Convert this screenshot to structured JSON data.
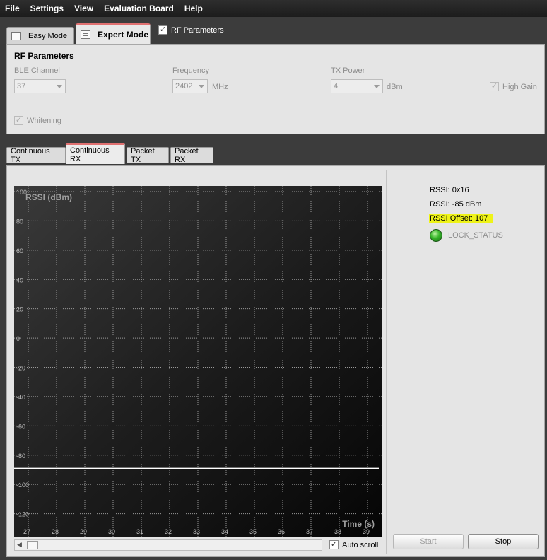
{
  "menu": [
    "File",
    "Settings",
    "View",
    "Evaluation Board",
    "Help"
  ],
  "mode_tabs": {
    "easy": "Easy Mode",
    "expert": "Expert Mode",
    "active": "Expert Mode"
  },
  "rf_toggle": {
    "label": "RF Parameters",
    "checked": true
  },
  "rf_params": {
    "title": "RF Parameters",
    "ble_channel": {
      "label": "BLE Channel",
      "value": "37"
    },
    "frequency": {
      "label": "Frequency",
      "value": "2402",
      "unit": "MHz"
    },
    "tx_power": {
      "label": "TX Power",
      "value": "4",
      "unit": "dBm"
    },
    "high_gain": {
      "label": "High Gain",
      "checked": true
    },
    "whitening": {
      "label": "Whitening",
      "checked": true
    }
  },
  "function_tabs": [
    "Continuous TX",
    "Continuous RX",
    "Packet TX",
    "Packet RX"
  ],
  "active_function_tab": "Continuous RX",
  "status": {
    "rssi_hex": "RSSI: 0x16",
    "rssi_dbm": "RSSI: -85 dBm",
    "rssi_offset": "RSSI Offset: 107",
    "lock_status": "LOCK_STATUS"
  },
  "chart_data": {
    "type": "line",
    "ylabel": "RSSI (dBm)",
    "xlabel": "Time (s)",
    "yticks": [
      100,
      80,
      60,
      40,
      20,
      0,
      -20,
      -40,
      -60,
      -80,
      -100,
      -120
    ],
    "xticks": [
      27,
      28,
      29,
      30,
      31,
      32,
      33,
      34,
      35,
      36,
      37,
      38,
      39
    ],
    "ylim": [
      -140,
      100
    ],
    "xlim": [
      27,
      39.5
    ],
    "grid": true,
    "background": "#141414",
    "line_color": "#ffffff",
    "series": [
      {
        "x": [
          27,
          39.5
        ],
        "values": [
          -89,
          -89
        ]
      }
    ]
  },
  "auto_scroll": {
    "label": "Auto scroll",
    "checked": true
  },
  "buttons": {
    "start": "Start",
    "stop": "Stop"
  },
  "colors": {
    "highlight": "#eef318",
    "active_tab_accent": "#e07070",
    "lock_led": "#37b62a"
  }
}
